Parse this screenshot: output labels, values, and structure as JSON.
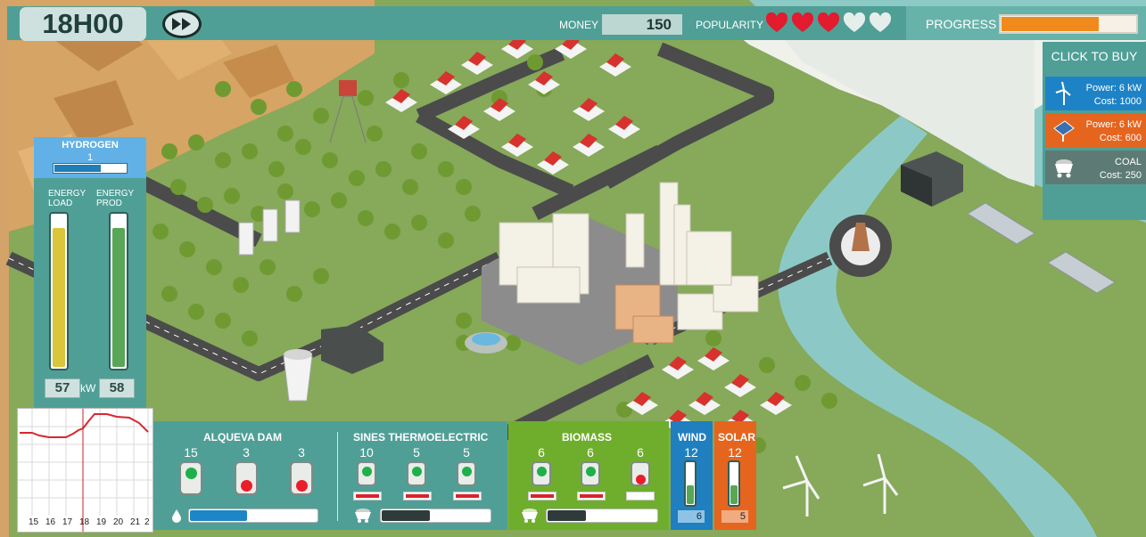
{
  "clock": "18H00",
  "topbar": {
    "money_label": "MONEY",
    "money_value": "150",
    "popularity_label": "POPULARITY",
    "hearts_total": 5,
    "hearts_filled": 3,
    "progress_label": "PROGRESS",
    "progress_fraction": 0.72
  },
  "buy_panel": {
    "title": "CLICK TO BUY",
    "items": [
      {
        "icon": "wind-turbine-icon",
        "line1": "Power: 6 kW",
        "line2": "Cost: 1000",
        "color": "#1e83c6"
      },
      {
        "icon": "solar-panel-icon",
        "line1": "Power: 6 kW",
        "line2": "Cost: 600",
        "color": "#e5651f"
      },
      {
        "icon": "coal-cart-icon",
        "line1": "COAL",
        "line2": "Cost: 250",
        "color": "#5d7b74"
      }
    ]
  },
  "hydrogen": {
    "title": "HYDROGEN",
    "value": "1",
    "bar_fraction": 0.65,
    "energy_load_label": "ENERGY LOAD",
    "energy_prod_label": "ENERGY PROD",
    "energy_load": "57",
    "energy_prod": "58",
    "unit": "kW",
    "load_fraction": 0.92,
    "prod_fraction": 0.92
  },
  "graph": {
    "x_ticks": [
      "15",
      "16",
      "17",
      "18",
      "19",
      "20",
      "21",
      "2"
    ],
    "marker_tick": "18"
  },
  "plants": {
    "alqueva": {
      "title": "ALQUEVA DAM",
      "units": [
        {
          "value": "15",
          "state": "on"
        },
        {
          "value": "3",
          "state": "off"
        },
        {
          "value": "3",
          "state": "off"
        }
      ],
      "resource_fraction": 0.45
    },
    "sines": {
      "title": "SINES THERMOELECTRIC",
      "units": [
        {
          "value": "10",
          "state": "on"
        },
        {
          "value": "5",
          "state": "on"
        },
        {
          "value": "5",
          "state": "on"
        }
      ],
      "resource_fraction": 0.45
    },
    "biomass": {
      "title": "BIOMASS",
      "units": [
        {
          "value": "6",
          "state": "on"
        },
        {
          "value": "6",
          "state": "on"
        },
        {
          "value": "6",
          "state": "off"
        }
      ],
      "resource_fraction": 0.35
    },
    "wind": {
      "title": "WIND",
      "value": "12",
      "count": "6",
      "fraction": 0.45
    },
    "solar": {
      "title": "SOLAR",
      "value": "12",
      "count": "5",
      "fraction": 0.45
    }
  },
  "colors": {
    "teal": "#4f9f96",
    "on_green": "#1fb04a",
    "off_red": "#ea1e2b",
    "progress_orange": "#f08a1c",
    "heart_red": "#e21b2f",
    "heart_empty": "#e6eeec"
  }
}
